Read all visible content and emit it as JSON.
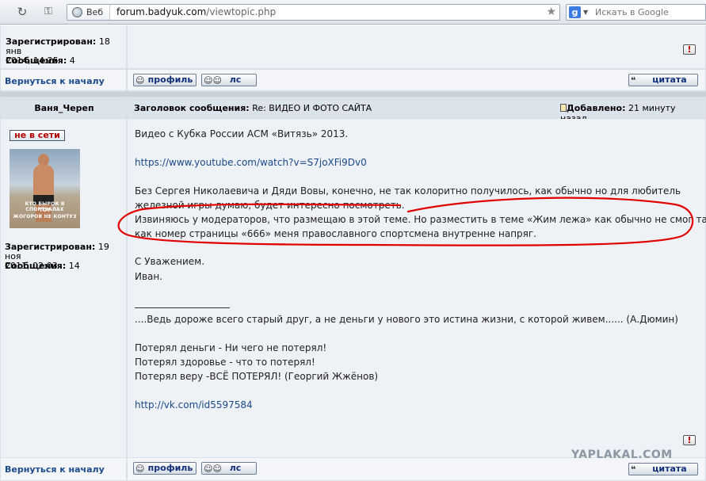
{
  "browser": {
    "site_chip": "Веб",
    "url_domain": "forum.badyuk.com",
    "url_path": "/viewtopic.php",
    "search_placeholder": "Искать в Google",
    "search_engine_letter": "g"
  },
  "prev_post": {
    "registered_label": "Зарегистрирован:",
    "registered_value_1": "18 янв",
    "registered_value_2": "2014, 14:25",
    "messages_label": "Сообщения:",
    "messages_value": "4",
    "back_to_top": "Вернуться к началу",
    "profile_btn": "профиль",
    "pm_btn": "лс",
    "quote_btn": "цитата"
  },
  "post": {
    "author": "Ваня_Череп",
    "subject_label": "Заголовок сообщения:",
    "subject_value": "Re: ВИДЕО И ФОТО САЙТА",
    "added_label": "Добавлено:",
    "added_value": "21 минуту назад",
    "status": "не в сети",
    "avatar_caption_1": "КТО БЫРОК В СПОРТЗАЛАХ",
    "avatar_caption_2": "ТОТ",
    "avatar_caption_3": "ЖОГОРОВ НЕ КОНТУЗ",
    "registered_label": "Зарегистрирован:",
    "registered_value_1": "19 ноя",
    "registered_value_2": "2011, 02:03",
    "messages_label": "Сообщения:",
    "messages_value": "14",
    "lines": {
      "l1": "Видео с Кубка России АСМ «Витязь» 2013.",
      "l2": "https://www.youtube.com/watch?v=S7joXFi9Dv0",
      "l3": "Без Сергея Николаевича и Дяди Вовы, конечно, не так колоритно получилось, как обычно но для любитель",
      "l4": "железной игры думаю, будет интересно посмотреть.",
      "l5": "Извиняюсь у модераторов, что размещаю в этой теме. Но разместить в теме «Жим лежа» как обычно не смог так",
      "l6": "как номер страницы «666» меня православного спортсмена внутренне напряг.",
      "l7": "С Уважением.",
      "l8": "Иван."
    },
    "signature": {
      "s1": "....Ведь дороже всего старый друг, а не деньги у нового это истина жизни, с которой живем...... (А.Дюмин)",
      "s2": "Потерял деньги - Ни чего не потерял!",
      "s3": "Потерял здоровье - что то потерял!",
      "s4": "Потерял веру -ВСЁ ПОТЕРЯЛ!  (Георгий Жжёнов)",
      "s5": "http://vk.com/id5597584"
    },
    "back_to_top": "Вернуться к началу",
    "profile_btn": "профиль",
    "pm_btn": "лс",
    "quote_btn": "цитата"
  },
  "watermark": "YAPLAKAL.COM",
  "colors": {
    "link": "#1a4a8a",
    "annotation_red": "#e00000",
    "offline_red": "#b00000"
  }
}
